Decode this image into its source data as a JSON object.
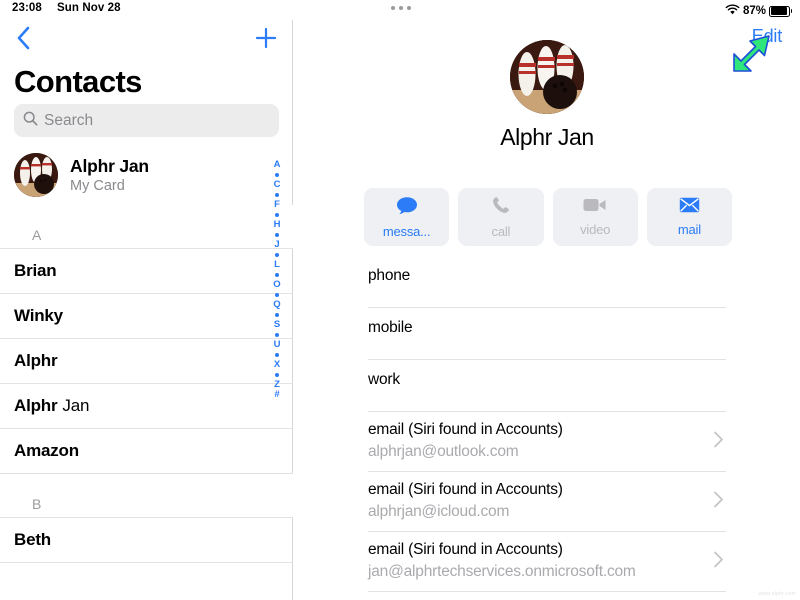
{
  "status_bar": {
    "time": "23:08",
    "date": "Sun Nov 28",
    "battery_percent": "87%",
    "wifi_icon": "wifi-icon",
    "battery_icon": "battery-full-icon"
  },
  "sidebar": {
    "back_icon": "chevron-left-icon",
    "add_icon": "plus-icon",
    "title": "Contacts",
    "search": {
      "placeholder": "Search",
      "icon": "search-icon"
    },
    "my_card": {
      "name": "Alphr Jan",
      "subtitle": "My Card",
      "avatar": "bowling-avatar"
    },
    "rows": [
      {
        "type": "header",
        "text": "A"
      },
      {
        "type": "contact",
        "bold": "Brian",
        "regular": ""
      },
      {
        "type": "contact",
        "bold": "Winky",
        "regular": ""
      },
      {
        "type": "contact",
        "bold": "Alphr",
        "regular": ""
      },
      {
        "type": "contact",
        "bold": "Alphr",
        "regular": "Jan"
      },
      {
        "type": "contact",
        "bold": "Amazon",
        "regular": ""
      },
      {
        "type": "header",
        "text": "B"
      },
      {
        "type": "contact",
        "bold": "Beth",
        "regular": ""
      }
    ],
    "index": [
      "A",
      "•",
      "C",
      "•",
      "F",
      "•",
      "H",
      "•",
      "J",
      "•",
      "L",
      "•",
      "O",
      "•",
      "Q",
      "•",
      "S",
      "•",
      "U",
      "•",
      "X",
      "•",
      "Z",
      "#"
    ]
  },
  "detail": {
    "multitask_icon": "multitask-dots-icon",
    "edit_label": "Edit",
    "avatar": "bowling-avatar",
    "name": "Alphr Jan",
    "actions": [
      {
        "label": "messa...",
        "icon": "message-bubble-icon",
        "enabled": true
      },
      {
        "label": "call",
        "icon": "phone-icon",
        "enabled": false
      },
      {
        "label": "video",
        "icon": "video-camera-icon",
        "enabled": false
      },
      {
        "label": "mail",
        "icon": "envelope-icon",
        "enabled": true
      }
    ],
    "fields": [
      {
        "label": "phone",
        "value": "",
        "chevron": false
      },
      {
        "label": "mobile",
        "value": "",
        "chevron": false
      },
      {
        "label": "work",
        "value": "",
        "chevron": false
      },
      {
        "label": "email (Siri found in Accounts)",
        "value": "alphrjan@outlook.com",
        "chevron": true
      },
      {
        "label": "email (Siri found in Accounts)",
        "value": "alphrjan@icloud.com",
        "chevron": true
      },
      {
        "label": "email (Siri found in Accounts)",
        "value": "jan@alphrtechservices.onmicrosoft.com",
        "chevron": true
      }
    ]
  },
  "annotation": {
    "arrow_icon": "green-arrow-pointing-up-right",
    "color": "#2fe67a",
    "target": "Edit"
  },
  "colors": {
    "accent": "#2b7cf6",
    "text": "#000000",
    "muted": "#8a8a8e",
    "separator": "#e3e3e5",
    "chip_bg": "#eef0f3"
  },
  "watermark": "www.alphr.com"
}
